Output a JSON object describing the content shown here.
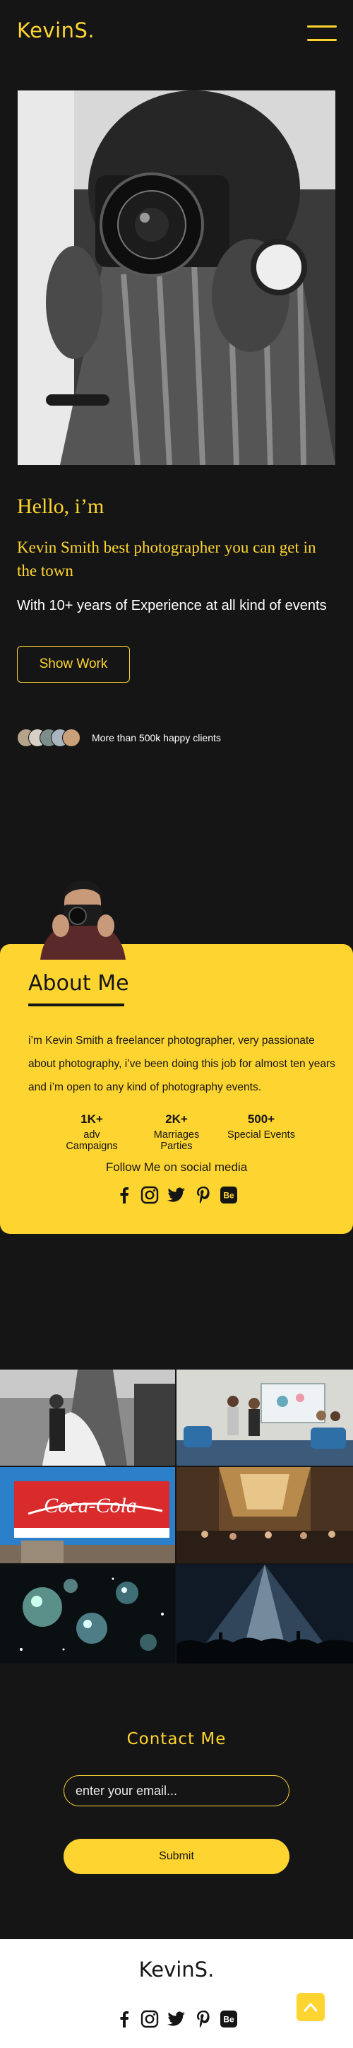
{
  "header": {
    "logo": "KevinS.",
    "menu_icon": "hamburger-menu-icon"
  },
  "hero": {
    "photo": "photographer-with-camera-image",
    "title": "Hello, i’m",
    "subtitle": "Kevin Smith best photographer you can get in the town",
    "description": "With 10+ years of Experience at all kind of events",
    "cta_label": "Show Work",
    "clients_text": "More than 500k happy clients"
  },
  "about": {
    "title": "About Me",
    "text": "i’m Kevin Smith a freelancer photographer, very passionate about photography, i’ve been doing this job for almost ten years and i’m open to any kind of photography events.",
    "stats": [
      {
        "value": "1K+",
        "label": "adv Campaigns"
      },
      {
        "value": "2K+",
        "label": "Marriages Parties"
      },
      {
        "value": "500+",
        "label": "Special Events"
      }
    ],
    "follow_text": "Follow Me on social media",
    "social": [
      "facebook-icon",
      "instagram-icon",
      "twitter-icon",
      "pinterest-icon",
      "behance-icon"
    ]
  },
  "gallery": {
    "images": [
      "wedding-photo",
      "conference-photo",
      "coca-cola-billboard-photo",
      "event-hall-photo",
      "disco-balls-photo",
      "concert-crowd-photo"
    ]
  },
  "contact": {
    "title": "Contact Me",
    "email_placeholder": "enter your email...",
    "submit_label": "Submit"
  },
  "footer": {
    "logo": "KevinS.",
    "social": [
      "facebook-icon",
      "instagram-icon",
      "twitter-icon",
      "pinterest-icon",
      "behance-icon"
    ],
    "scroll_top_icon": "chevron-up-icon"
  },
  "colors": {
    "background": "#151515",
    "accent": "#fed530",
    "text_dark": "#151515",
    "footer_bg": "#ffffff"
  }
}
